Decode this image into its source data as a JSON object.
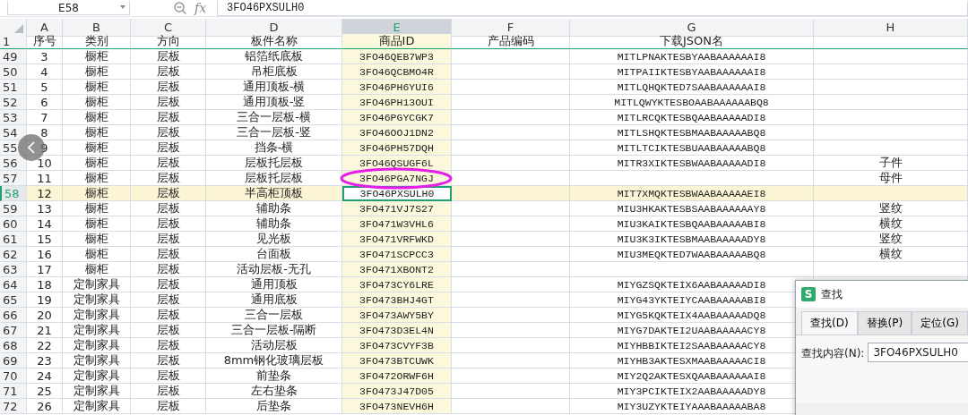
{
  "name_box": {
    "value": "E58"
  },
  "formula_bar": {
    "fx_label": "fx",
    "value": "3FO46PXSULH0"
  },
  "columns": [
    {
      "letter": "A",
      "selected": false
    },
    {
      "letter": "B",
      "selected": false
    },
    {
      "letter": "C",
      "selected": false
    },
    {
      "letter": "D",
      "selected": false
    },
    {
      "letter": "E",
      "selected": true
    },
    {
      "letter": "F",
      "selected": false
    },
    {
      "letter": "G",
      "selected": false
    },
    {
      "letter": "H",
      "selected": false
    }
  ],
  "rows": [
    {
      "row": "1",
      "selected": false,
      "circled": false,
      "cells": [
        "序号",
        "类别",
        "方向",
        "板件名称",
        "商品ID",
        "产品编码",
        "下载JSON名",
        null
      ]
    },
    {
      "row": "49",
      "selected": false,
      "circled": false,
      "cells": [
        "3",
        "橱柜",
        "层板",
        "铝箔纸底板",
        "3FO46QEB7WP3",
        null,
        "MITLPNAKTESBYAABAAAAAAI8",
        null
      ]
    },
    {
      "row": "50",
      "selected": false,
      "circled": false,
      "cells": [
        "4",
        "橱柜",
        "层板",
        "吊柜底板",
        "3FO46QCBMO4R",
        null,
        "MITPAIIKTESBYAABAAAAAAI8",
        null
      ]
    },
    {
      "row": "51",
      "selected": false,
      "circled": false,
      "cells": [
        "5",
        "橱柜",
        "层板",
        "通用顶板-横",
        "3FO46PH6YUI6",
        null,
        "MITLQHQKTED7SAABAAAAAAI8",
        null
      ]
    },
    {
      "row": "52",
      "selected": false,
      "circled": false,
      "cells": [
        "6",
        "橱柜",
        "层板",
        "通用顶板-竖",
        "3FO46PH13OUI",
        null,
        "MITLQWYKTESBOAABAAAAAABQ8",
        null
      ]
    },
    {
      "row": "53",
      "selected": false,
      "circled": false,
      "cells": [
        "7",
        "橱柜",
        "层板",
        "三合一层板-横",
        "3FO46PGYCGK7",
        null,
        "MITLRCQKTESBQAABAAAAADI8",
        null
      ]
    },
    {
      "row": "54",
      "selected": false,
      "circled": false,
      "cells": [
        "8",
        "橱柜",
        "层板",
        "三合一层板-竖",
        "3FO46OOJ1DN2",
        null,
        "MITLSHQKTESBMAABAAAAABQ8",
        null
      ]
    },
    {
      "row": "55",
      "selected": false,
      "circled": false,
      "cells": [
        "9",
        "橱柜",
        "层板",
        "挡条-横",
        "3FO46PH57DQH",
        null,
        "MITLTCIKTESBUAABAAAAABQ8",
        null
      ]
    },
    {
      "row": "56",
      "selected": false,
      "circled": false,
      "cells": [
        "10",
        "橱柜",
        "层板",
        "层板托层板",
        "3FO46QSUGF6L",
        null,
        "MITR3XIKTESBWAABAAAAADI8",
        "子件"
      ]
    },
    {
      "row": "57",
      "selected": false,
      "circled": true,
      "cells": [
        "11",
        "橱柜",
        "层板",
        "层板托层板",
        "3FO46PGA7NGJ",
        null,
        null,
        "母件"
      ]
    },
    {
      "row": "58",
      "selected": true,
      "circled": false,
      "cells": [
        "12",
        "橱柜",
        "层板",
        "半高柜顶板",
        "3FO46PXSULH0",
        null,
        "MIT7XMQKTESBWAABAAAAAEI8",
        null
      ]
    },
    {
      "row": "59",
      "selected": false,
      "circled": false,
      "cells": [
        "13",
        "橱柜",
        "层板",
        "辅助条",
        "3FO471VJ7S27",
        null,
        "MIU3HKAKTESBSAABAAAAAAY8",
        "竖纹"
      ]
    },
    {
      "row": "60",
      "selected": false,
      "circled": false,
      "cells": [
        "14",
        "橱柜",
        "层板",
        "辅助条",
        "3FO471W3VHL6",
        null,
        "MIU3KAIKTESBQAABAAAAABI8",
        "横纹"
      ]
    },
    {
      "row": "61",
      "selected": false,
      "circled": false,
      "cells": [
        "15",
        "橱柜",
        "层板",
        "见光板",
        "3FO471VRFWKD",
        null,
        "MIU3K3IKTESBMAABAAAAADY8",
        "竖纹"
      ]
    },
    {
      "row": "62",
      "selected": false,
      "circled": false,
      "cells": [
        "16",
        "橱柜",
        "层板",
        "台面板",
        "3FO471SCPCC3",
        null,
        "MIU3MEQKTED7WAABAAAAABQ8",
        "横纹"
      ]
    },
    {
      "row": "63",
      "selected": false,
      "circled": false,
      "cells": [
        "17",
        "橱柜",
        "层板",
        "活动层板-无孔",
        "3FO471XBONT2",
        null,
        null,
        null
      ]
    },
    {
      "row": "64",
      "selected": false,
      "circled": false,
      "cells": [
        "18",
        "定制家具",
        "层板",
        "通用顶板",
        "3FO473CY6LRE",
        null,
        "MIYGZSQKTEIX6AABAAAAADI8",
        null
      ]
    },
    {
      "row": "65",
      "selected": false,
      "circled": false,
      "cells": [
        "19",
        "定制家具",
        "层板",
        "通用底板",
        "3FO473BHJ4GT",
        null,
        "MIYG43YKTEIYCAABAAAAABI8",
        null
      ]
    },
    {
      "row": "66",
      "selected": false,
      "circled": false,
      "cells": [
        "20",
        "定制家具",
        "层板",
        "三合一层板",
        "3FO473AWY5BY",
        null,
        "MIYG5KQKTEIX4AABAAAAADQ8",
        null
      ]
    },
    {
      "row": "67",
      "selected": false,
      "circled": false,
      "cells": [
        "21",
        "定制家具",
        "层板",
        "三合一层板-隔断",
        "3FO473D3EL4N",
        null,
        "MIYG7DAKTEI2UAABAAAAACY8",
        null
      ]
    },
    {
      "row": "68",
      "selected": false,
      "circled": false,
      "cells": [
        "22",
        "定制家具",
        "层板",
        "活动层板",
        "3FO473CVYF3B",
        null,
        "MIYHBBIKTEI2SAABAAAAACY8",
        null
      ]
    },
    {
      "row": "69",
      "selected": false,
      "circled": false,
      "cells": [
        "23",
        "定制家具",
        "层板",
        "8mm钢化玻璃层板",
        "3FO473BTCUWK",
        null,
        "MIYHB3AKTESXMAABAAAAACI8",
        null
      ]
    },
    {
      "row": "70",
      "selected": false,
      "circled": false,
      "cells": [
        "24",
        "定制家具",
        "层板",
        "前垫条",
        "3FO472ORWF6H",
        null,
        "MIY2Q2AKTESXQAABAAAAAAI8",
        null
      ]
    },
    {
      "row": "71",
      "selected": false,
      "circled": false,
      "cells": [
        "25",
        "定制家具",
        "层板",
        "左右垫条",
        "3FO473J47D05",
        null,
        "MIY3PCIKTEIX2AABAAAAADY8",
        null
      ]
    },
    {
      "row": "72",
      "selected": false,
      "circled": false,
      "cells": [
        "26",
        "定制家具",
        "层板",
        "后垫条",
        "3FO473NEVH6H",
        null,
        "MIY3UZYKTEIYAAABAAAAABA8",
        null
      ]
    }
  ],
  "back_button": {
    "visible": true
  },
  "find_dialog": {
    "app_icon": "S",
    "title": "查找",
    "tabs": [
      {
        "label": "查找(D)",
        "selected": true
      },
      {
        "label": "替换(P)",
        "selected": false
      },
      {
        "label": "定位(G)",
        "selected": false
      }
    ],
    "field_label": "查找内容(N):",
    "field_value": "3FO46PXSULH0"
  }
}
